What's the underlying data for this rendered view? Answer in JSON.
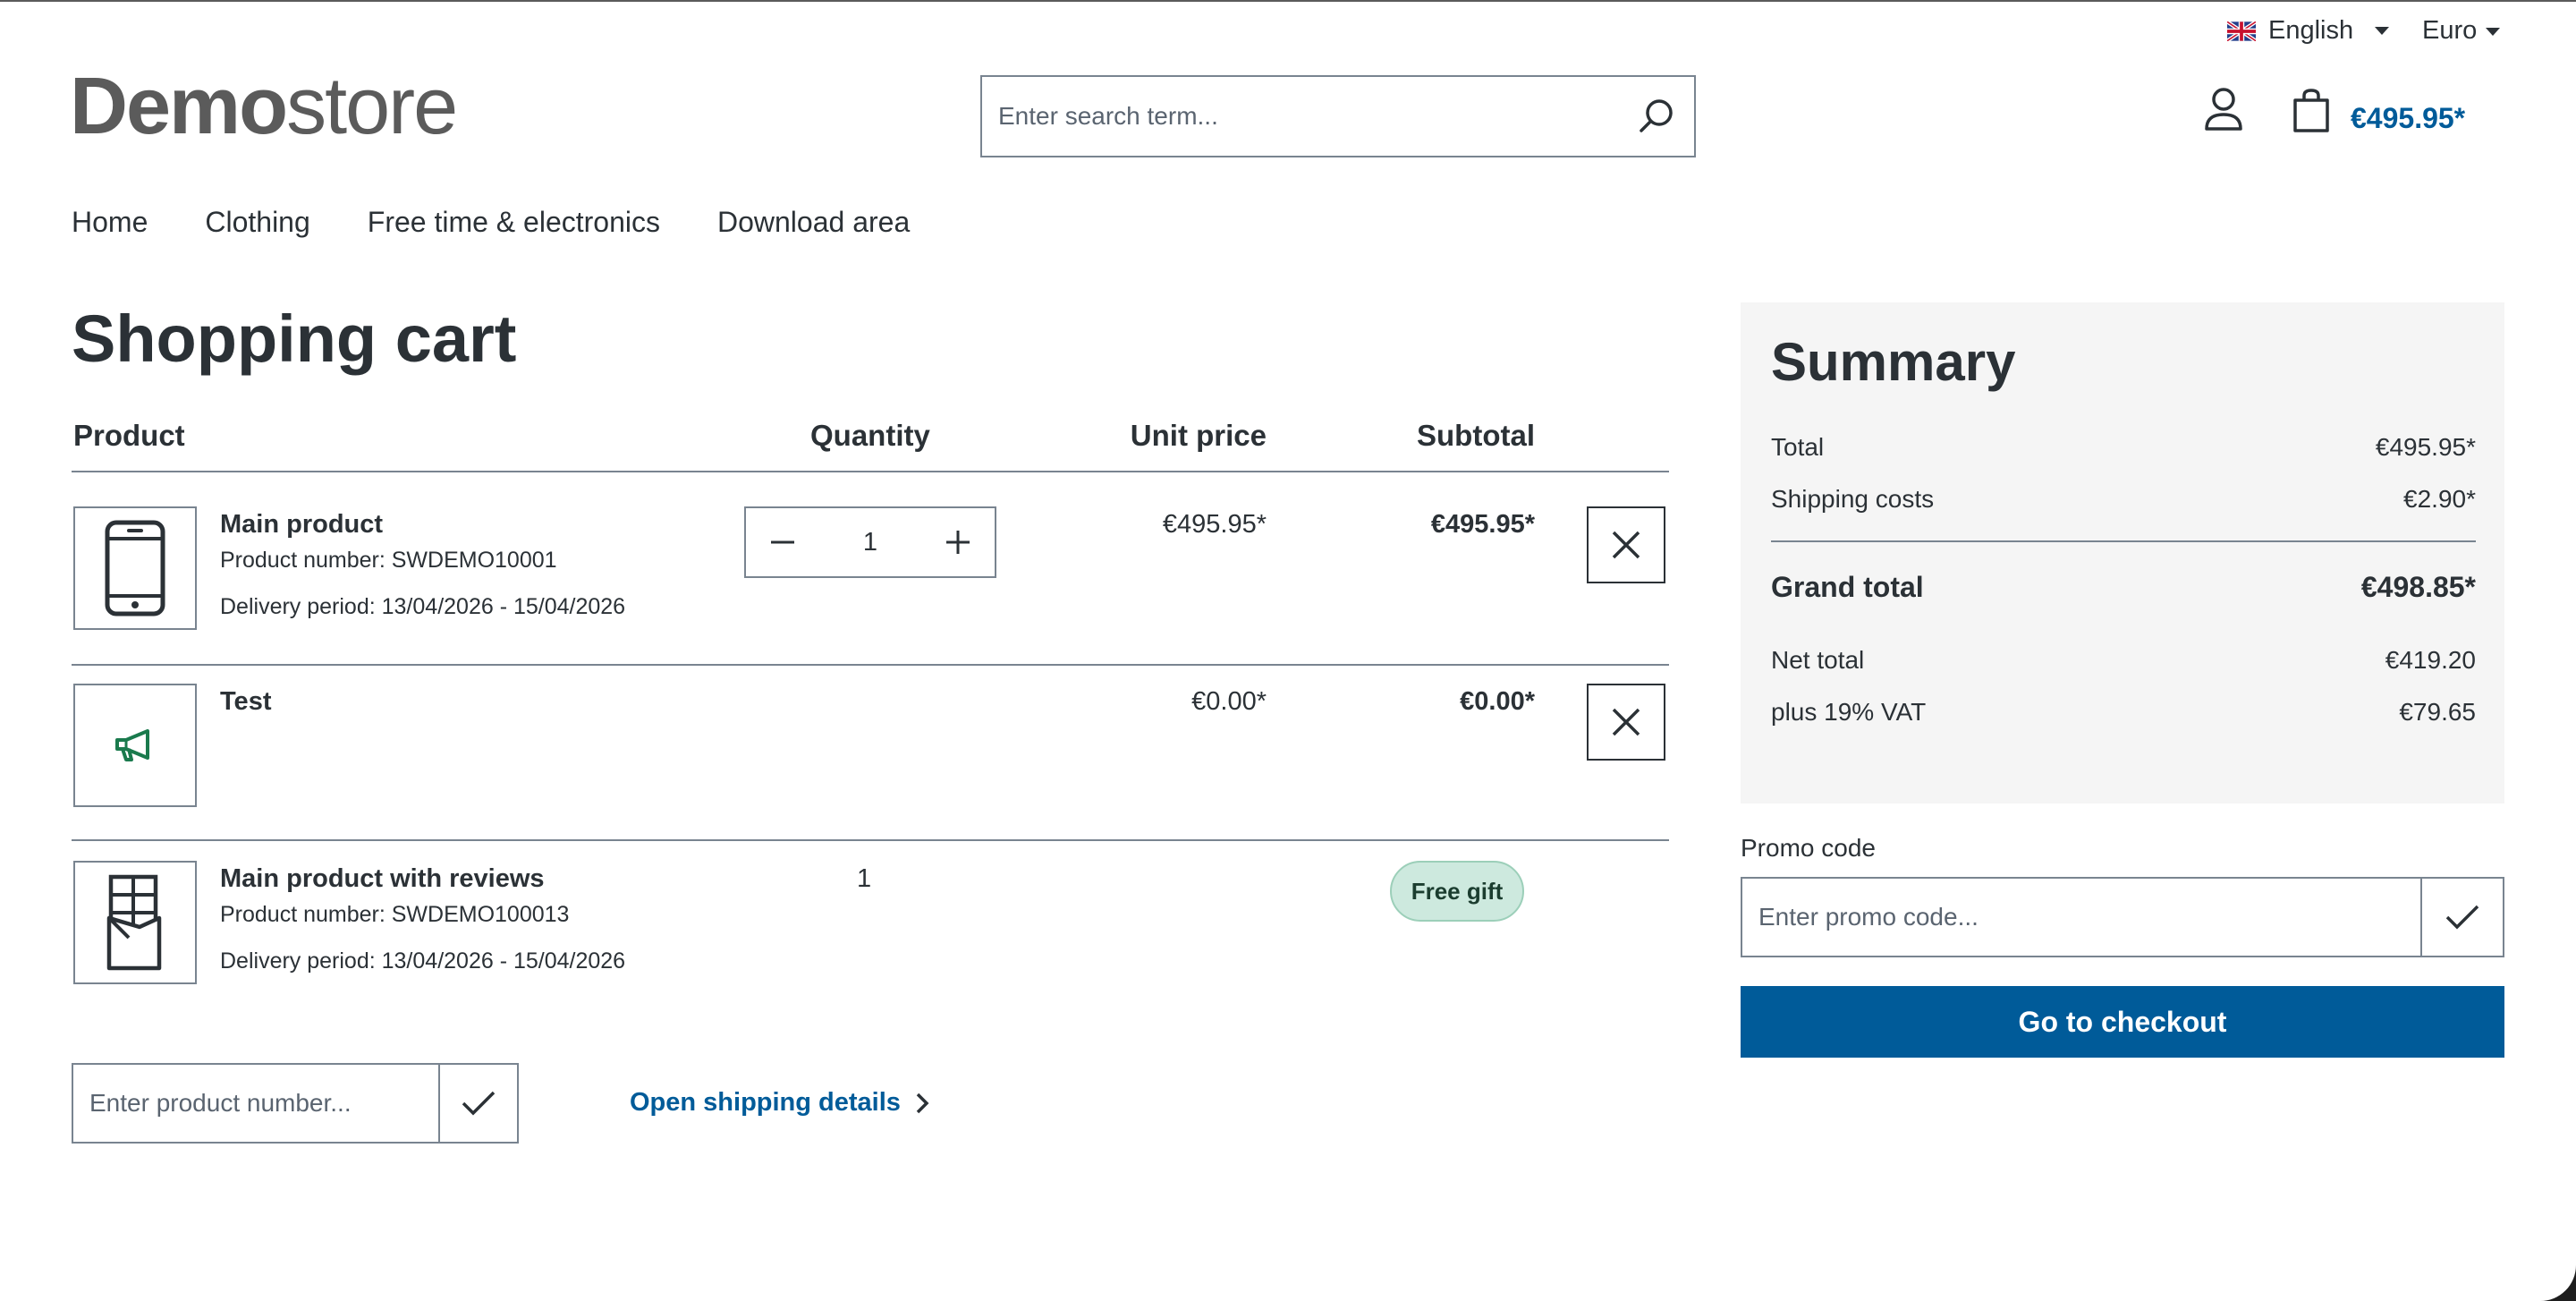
{
  "topbar": {
    "language": "English",
    "currency": "Euro"
  },
  "logo": {
    "bold": "Demo",
    "light": "store"
  },
  "search": {
    "placeholder": "Enter search term..."
  },
  "header": {
    "cart_total": "€495.95*"
  },
  "nav": [
    "Home",
    "Clothing",
    "Free time & electronics",
    "Download area"
  ],
  "page_title": "Shopping cart",
  "table": {
    "headers": {
      "product": "Product",
      "quantity": "Quantity",
      "unit_price": "Unit price",
      "subtotal": "Subtotal"
    },
    "rows": [
      {
        "name": "Main product",
        "number": "Product number: SWDEMO10001",
        "delivery": "Delivery period: 13/04/2026 - 15/04/2026",
        "quantity": "1",
        "unit_price": "€495.95*",
        "subtotal": "€495.95*",
        "icon": "smartphone-icon"
      },
      {
        "name": "Test",
        "unit_price": "€0.00*",
        "subtotal": "€0.00*",
        "icon": "megaphone-icon"
      },
      {
        "name": "Main product with reviews",
        "number": "Product number: SWDEMO100013",
        "delivery": "Delivery period: 13/04/2026 - 15/04/2026",
        "quantity": "1",
        "badge": "Free gift",
        "icon": "chocolate-bar-icon"
      }
    ]
  },
  "add_product": {
    "placeholder": "Enter product number..."
  },
  "shipping_link": "Open shipping details",
  "summary": {
    "title": "Summary",
    "total_label": "Total",
    "total_value": "€495.95*",
    "shipping_label": "Shipping costs",
    "shipping_value": "€2.90*",
    "grand_label": "Grand total",
    "grand_value": "€498.85*",
    "net_label": "Net total",
    "net_value": "€419.20",
    "vat_label": "plus 19% VAT",
    "vat_value": "€79.65"
  },
  "promo": {
    "label": "Promo code",
    "placeholder": "Enter promo code..."
  },
  "checkout_label": "Go to checkout",
  "colors": {
    "brand_blue": "#005b99",
    "border": "#798490",
    "text": "#2b3136",
    "gift_bg": "#cde9de",
    "icon_green": "#1a7a4d"
  }
}
